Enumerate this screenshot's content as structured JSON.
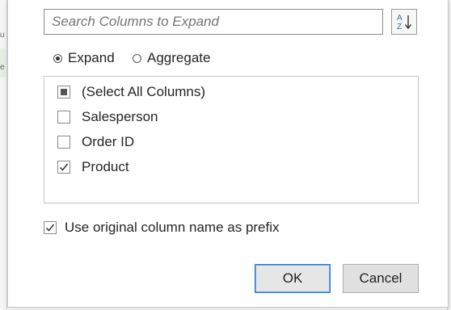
{
  "background": {
    "left_glyphs": [
      "u",
      "e"
    ]
  },
  "search": {
    "placeholder": "Search Columns to Expand",
    "value": ""
  },
  "sort_button": {
    "icon": "sort-az-icon",
    "label_a": "A",
    "label_z": "Z"
  },
  "mode": {
    "options": [
      {
        "label": "Expand",
        "selected": true
      },
      {
        "label": "Aggregate",
        "selected": false
      }
    ]
  },
  "columns": [
    {
      "label": "(Select All Columns)",
      "state": "partial"
    },
    {
      "label": "Salesperson",
      "state": "unchecked"
    },
    {
      "label": "Order ID",
      "state": "unchecked"
    },
    {
      "label": "Product",
      "state": "checked"
    }
  ],
  "prefix_option": {
    "label": "Use original column name as prefix",
    "checked": true
  },
  "buttons": {
    "ok": "OK",
    "cancel": "Cancel"
  },
  "colors": {
    "accent_border": "#2b7ad2",
    "background_band": "#e4efe2"
  }
}
